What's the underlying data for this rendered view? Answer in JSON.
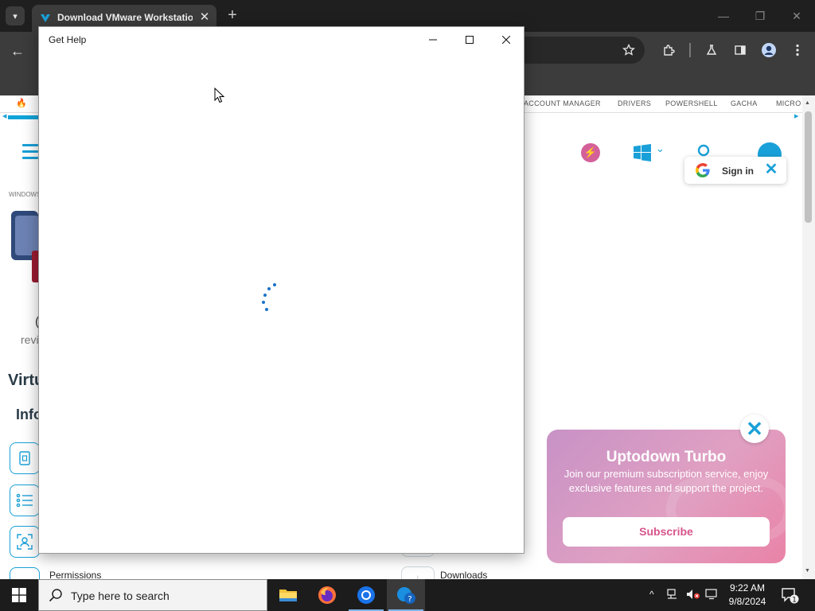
{
  "browser": {
    "tab_title": "Download VMware Workstation",
    "tab_close": "✕",
    "new_tab": "+",
    "bookmarks": [
      "ACCOUNT MANAGER",
      "DRIVERS",
      "POWERSHELL",
      "GACHA",
      "MICRO"
    ]
  },
  "webpage": {
    "breadcrumb": "WINDOWS",
    "rev_text": "revi",
    "dash_text": "(",
    "virt_heading": "Virtu",
    "info_heading": "Info",
    "permissions": "Permissions",
    "downloads": "Downloads",
    "signin": "Sign in",
    "promo": {
      "title": "Uptodown Turbo",
      "description": "Join our premium subscription service, enjoy exclusive features and support the project.",
      "subscribe": "Subscribe"
    }
  },
  "dialog": {
    "title": "Get Help"
  },
  "taskbar": {
    "search_placeholder": "Type here to search",
    "time": "9:22 AM",
    "date": "9/8/2024",
    "notification_count": "1"
  },
  "colors": {
    "accent": "#1aa0d8",
    "promo_button_text": "#d6558c",
    "chrome_dark": "#1f1f1f"
  }
}
